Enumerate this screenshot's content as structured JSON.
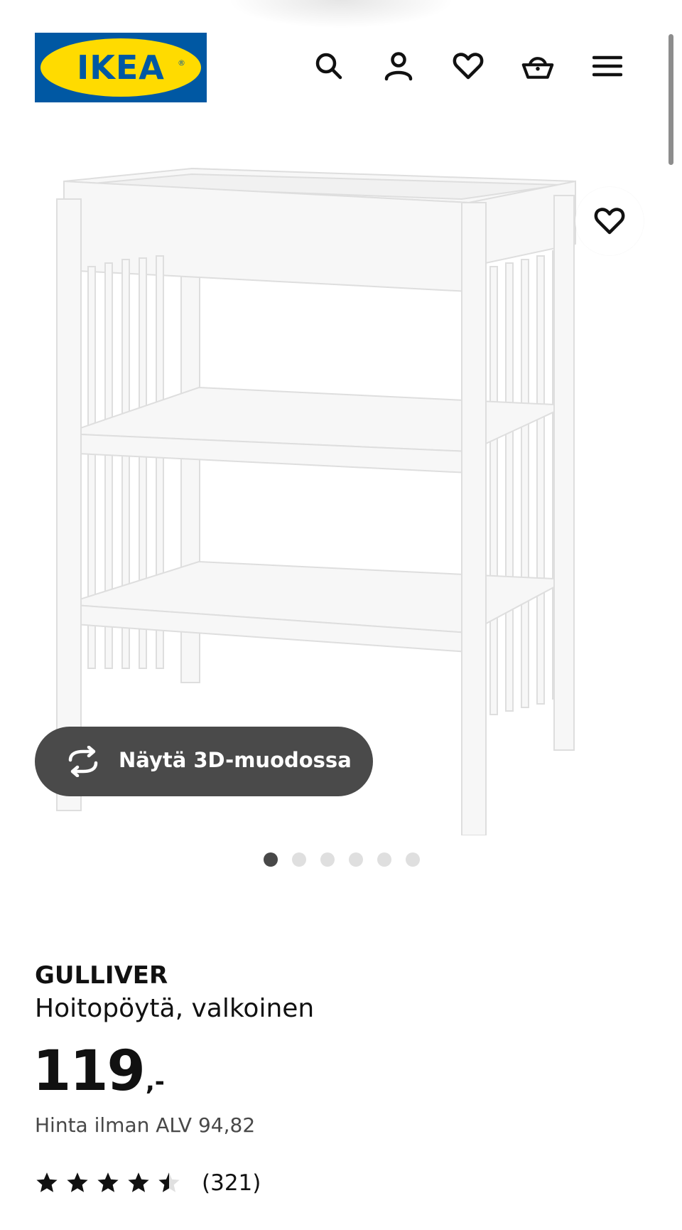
{
  "header": {
    "logo_text": "IKEA",
    "icons": [
      "search-icon",
      "user-icon",
      "heart-icon",
      "basket-icon",
      "menu-icon"
    ]
  },
  "gallery": {
    "image_alt": "GULLIVER changing table",
    "view_3d_label": "Näytä 3D-muodossa",
    "dot_count": 6,
    "active_dot": 1
  },
  "product": {
    "name": "GULLIVER",
    "description": "Hoitopöytä, valkoinen",
    "price_integer": "119",
    "price_suffix": ",-",
    "vat_text": "Hinta ilman ALV 94,82",
    "rating": 4.5,
    "rating_max": 5,
    "review_count": "(321)"
  },
  "colors": {
    "brand_blue": "#0058a3",
    "brand_yellow": "#ffdb00",
    "button_dark": "#4a4a4a"
  }
}
